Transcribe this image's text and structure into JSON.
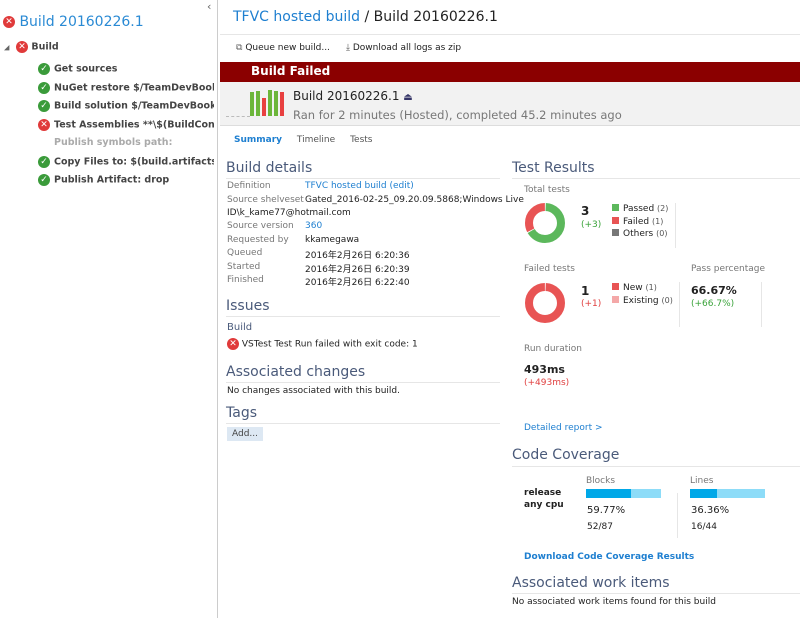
{
  "sidebar": {
    "title": "Build 20160226.1",
    "root": "Build",
    "steps": [
      {
        "label": "Get sources",
        "status": "success"
      },
      {
        "label": "NuGet restore $/TeamDevBook/Bo...",
        "status": "success"
      },
      {
        "label": "Build solution $/TeamDevBook/Bo...",
        "status": "success"
      },
      {
        "label": "Test Assemblies **\\$(BuildConfigur...",
        "status": "failed"
      },
      {
        "label": "Publish symbols path:",
        "status": "skipped"
      },
      {
        "label": "Copy Files to: $(build.artifactstagin...",
        "status": "success"
      },
      {
        "label": "Publish Artifact: drop",
        "status": "success"
      }
    ]
  },
  "header": {
    "definition_link": "TFVC hosted build",
    "separator": " / ",
    "build": "Build 20160226.1"
  },
  "toolbar": {
    "queue": "Queue new build...",
    "download": "Download all logs as zip"
  },
  "banner": {
    "status": "Build Failed",
    "color": "#8b0000",
    "build": "Build 20160226.1",
    "summary": "Ran for 2 minutes (Hosted), completed 45.2 minutes ago"
  },
  "tabs": [
    {
      "label": "Summary",
      "active": true
    },
    {
      "label": "Timeline"
    },
    {
      "label": "Tests"
    }
  ],
  "details": {
    "title": "Build details",
    "rows": [
      {
        "label": "Definition",
        "value": "TFVC hosted build (edit)",
        "link": true
      },
      {
        "label": "Source shelveset",
        "value": "Gated_2016-02-25_09.20.09.5868;Windows Live",
        "value2": "ID\\k_kame77@hotmail.com"
      },
      {
        "label": "Source version",
        "value": "360",
        "link": true
      },
      {
        "label": "Requested by",
        "value": "kkamegawa"
      },
      {
        "label": "Queued",
        "value": "2016年2月26日 6:20:36"
      },
      {
        "label": "Started",
        "value": "2016年2月26日 6:20:39"
      },
      {
        "label": "Finished",
        "value": "2016年2月26日 6:22:40"
      }
    ]
  },
  "issues": {
    "title": "Issues",
    "group": "Build",
    "message": "VSTest Test Run failed with exit code: 1"
  },
  "changes": {
    "title": "Associated changes",
    "message": "No changes associated with this build."
  },
  "tags": {
    "title": "Tags",
    "add": "Add..."
  },
  "tests": {
    "title": "Test Results",
    "total_label": "Total tests",
    "total": "3",
    "total_delta": "(+3)",
    "legend": [
      {
        "label": "Passed",
        "count": "(2)",
        "color": "#5cb85c",
        "value": 2
      },
      {
        "label": "Failed",
        "count": "(1)",
        "color": "#e85454",
        "value": 1
      },
      {
        "label": "Others",
        "count": "(0)",
        "color": "#777777",
        "value": 0
      }
    ],
    "failed_label": "Failed tests",
    "failed": "1",
    "failed_delta": "(+1)",
    "failed_legend": [
      {
        "label": "New",
        "count": "(1)",
        "color": "#e85454",
        "value": 1
      },
      {
        "label": "Existing",
        "count": "(0)",
        "color": "#f4a8a8",
        "value": 0
      }
    ],
    "pass_label": "Pass percentage",
    "pass": "66.67%",
    "pass_delta": "(+66.7%)",
    "duration_label": "Run duration",
    "duration": "493ms",
    "duration_delta": "(+493ms)",
    "report": "Detailed report >"
  },
  "coverage": {
    "title": "Code Coverage",
    "config1": "release",
    "config2": "any cpu",
    "blocks": {
      "label": "Blocks",
      "pct": "59.77%",
      "value": 59.77,
      "ratio": "52/87"
    },
    "lines": {
      "label": "Lines",
      "pct": "36.36%",
      "value": 36.36,
      "ratio": "16/44"
    },
    "download": "Download Code Coverage Results"
  },
  "work_items": {
    "title": "Associated work items",
    "message": "No associated work items found for this build"
  }
}
